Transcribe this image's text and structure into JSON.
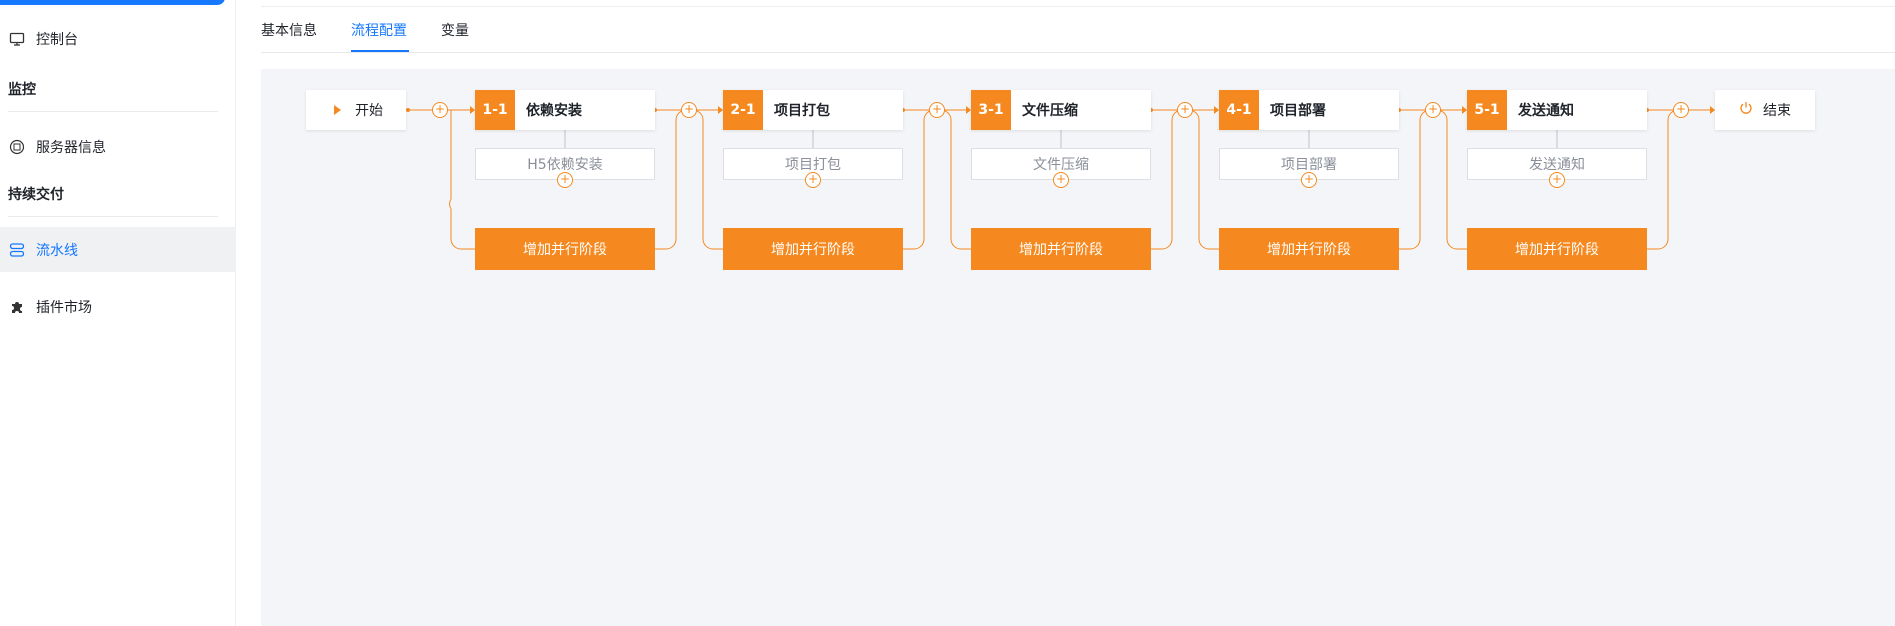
{
  "sidebar": {
    "items": [
      {
        "label": "控制台",
        "icon": "monitor-icon"
      },
      {
        "label": "服务器信息",
        "icon": "server-icon"
      },
      {
        "label": "流水线",
        "icon": "pipeline-icon",
        "active": true
      },
      {
        "label": "插件市场",
        "icon": "puzzle-icon"
      }
    ],
    "groups": [
      "监控",
      "持续交付"
    ]
  },
  "tabs": [
    {
      "label": "基本信息"
    },
    {
      "label": "流程配置",
      "active": true
    },
    {
      "label": "变量"
    }
  ],
  "flow": {
    "start_label": "开始",
    "end_label": "结束",
    "add_parallel_label": "增加并行阶段",
    "accent_color": "#f5891f",
    "stages": [
      {
        "num": "1-1",
        "title": "依赖安装",
        "task": "H5依赖安装"
      },
      {
        "num": "2-1",
        "title": "项目打包",
        "task": "项目打包"
      },
      {
        "num": "3-1",
        "title": "文件压缩",
        "task": "文件压缩"
      },
      {
        "num": "4-1",
        "title": "项目部署",
        "task": "项目部署"
      },
      {
        "num": "5-1",
        "title": "发送通知",
        "task": "发送通知"
      }
    ]
  },
  "colors": {
    "primary": "#1677ff",
    "canvas_bg": "#f4f5f8",
    "accent": "#f5891f"
  }
}
